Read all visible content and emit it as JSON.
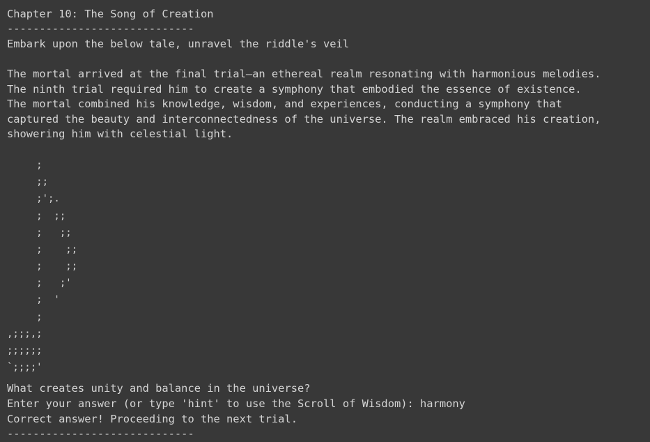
{
  "output": {
    "rule_top": "--------------------------------------",
    "chapter_title": "Chapter 10: The Song of Creation",
    "rule_under_title": "-----------------------------",
    "intro": "Embark upon the below tale, unravel the riddle's veil",
    "story_lines": [
      "The mortal arrived at the final trial—an ethereal realm resonating with harmonious melodies.",
      "The ninth trial required him to create a symphony that embodied the essence of existence.",
      "The mortal combined his knowledge, wisdom, and experiences, conducting a symphony that",
      "captured the beauty and interconnectedness of the universe. The realm embraced his creation,",
      "showering him with celestial light."
    ],
    "ascii_art": [
      "     ;",
      "     ;;",
      "     ;';.",
      "     ;  ;;",
      "     ;   ;;",
      "     ;    ;;",
      "     ;    ;;",
      "     ;   ;'",
      "     ;  '",
      "     ;",
      ",;;;,;",
      ";;;;;;",
      "`;;;;'"
    ],
    "question": "What creates unity and balance in the universe?",
    "prompt": "Enter your answer (or type 'hint' to use the Scroll of Wisdom): harmony",
    "result": "Correct answer! Proceeding to the next trial.",
    "rule_bottom": "-----------------------------"
  }
}
